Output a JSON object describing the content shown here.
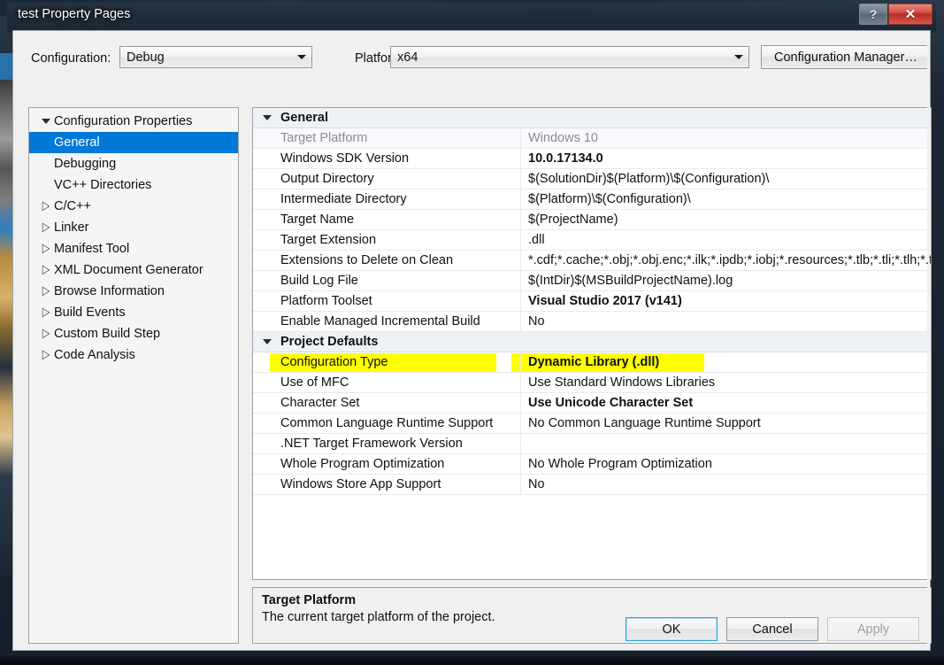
{
  "window": {
    "title": "test Property Pages",
    "help_button": "?",
    "close_button": "✕",
    "help_icon": "question-mark-icon",
    "close_icon": "close-x-icon"
  },
  "toolbar": {
    "configuration_label": "Configuration:",
    "configuration_value": "Debug",
    "platform_label": "Platform:",
    "platform_value": "x64",
    "configuration_manager_label": "Configuration Manager…"
  },
  "tree": {
    "items": [
      {
        "label": "Configuration Properties",
        "level": 0,
        "expander": "down",
        "selected": false
      },
      {
        "label": "General",
        "level": 1,
        "expander": "none",
        "selected": true
      },
      {
        "label": "Debugging",
        "level": 1,
        "expander": "none",
        "selected": false
      },
      {
        "label": "VC++ Directories",
        "level": 1,
        "expander": "none",
        "selected": false
      },
      {
        "label": "C/C++",
        "level": 1,
        "expander": "right",
        "selected": false
      },
      {
        "label": "Linker",
        "level": 1,
        "expander": "right",
        "selected": false
      },
      {
        "label": "Manifest Tool",
        "level": 1,
        "expander": "right",
        "selected": false
      },
      {
        "label": "XML Document Generator",
        "level": 1,
        "expander": "right",
        "selected": false
      },
      {
        "label": "Browse Information",
        "level": 1,
        "expander": "right",
        "selected": false
      },
      {
        "label": "Build Events",
        "level": 1,
        "expander": "right",
        "selected": false
      },
      {
        "label": "Custom Build Step",
        "level": 1,
        "expander": "right",
        "selected": false
      },
      {
        "label": "Code Analysis",
        "level": 1,
        "expander": "right",
        "selected": false
      }
    ]
  },
  "grid": {
    "rows": [
      {
        "kind": "section",
        "name": "General",
        "value": ""
      },
      {
        "kind": "prop",
        "name": "Target Platform",
        "value": "Windows 10",
        "disabled": true,
        "bold": false
      },
      {
        "kind": "prop",
        "name": "Windows SDK Version",
        "value": "10.0.17134.0",
        "disabled": false,
        "bold": true
      },
      {
        "kind": "prop",
        "name": "Output Directory",
        "value": "$(SolutionDir)$(Platform)\\$(Configuration)\\",
        "disabled": false,
        "bold": false
      },
      {
        "kind": "prop",
        "name": "Intermediate Directory",
        "value": "$(Platform)\\$(Configuration)\\",
        "disabled": false,
        "bold": false
      },
      {
        "kind": "prop",
        "name": "Target Name",
        "value": "$(ProjectName)",
        "disabled": false,
        "bold": false
      },
      {
        "kind": "prop",
        "name": "Target Extension",
        "value": ".dll",
        "disabled": false,
        "bold": false
      },
      {
        "kind": "prop",
        "name": "Extensions to Delete on Clean",
        "value": "*.cdf;*.cache;*.obj;*.obj.enc;*.ilk;*.ipdb;*.iobj;*.resources;*.tlb;*.tli;*.tlh;*.t",
        "disabled": false,
        "bold": false
      },
      {
        "kind": "prop",
        "name": "Build Log File",
        "value": "$(IntDir)$(MSBuildProjectName).log",
        "disabled": false,
        "bold": false
      },
      {
        "kind": "prop",
        "name": "Platform Toolset",
        "value": "Visual Studio 2017 (v141)",
        "disabled": false,
        "bold": true
      },
      {
        "kind": "prop",
        "name": "Enable Managed Incremental Build",
        "value": "No",
        "disabled": false,
        "bold": false
      },
      {
        "kind": "section",
        "name": "Project Defaults",
        "value": ""
      },
      {
        "kind": "prop",
        "name": "Configuration Type",
        "value": "Dynamic Library (.dll)",
        "disabled": false,
        "bold": true,
        "highlighted": true
      },
      {
        "kind": "prop",
        "name": "Use of MFC",
        "value": "Use Standard Windows Libraries",
        "disabled": false,
        "bold": false
      },
      {
        "kind": "prop",
        "name": "Character Set",
        "value": "Use Unicode Character Set",
        "disabled": false,
        "bold": true
      },
      {
        "kind": "prop",
        "name": "Common Language Runtime Support",
        "value": "No Common Language Runtime Support",
        "disabled": false,
        "bold": false
      },
      {
        "kind": "prop",
        "name": ".NET Target Framework Version",
        "value": "",
        "disabled": false,
        "bold": false
      },
      {
        "kind": "prop",
        "name": "Whole Program Optimization",
        "value": "No Whole Program Optimization",
        "disabled": false,
        "bold": false
      },
      {
        "kind": "prop",
        "name": "Windows Store App Support",
        "value": "No",
        "disabled": false,
        "bold": false
      }
    ]
  },
  "description": {
    "title": "Target Platform",
    "body": "The current target platform of the project."
  },
  "footer": {
    "ok_label": "OK",
    "cancel_label": "Cancel",
    "apply_label": "Apply"
  },
  "colors": {
    "selection": "#0078d7",
    "highlight": "#ffff00",
    "section_bg": "#eef2f7",
    "dialog_bg": "#f0f0f0",
    "close_button": "#c0392b"
  }
}
